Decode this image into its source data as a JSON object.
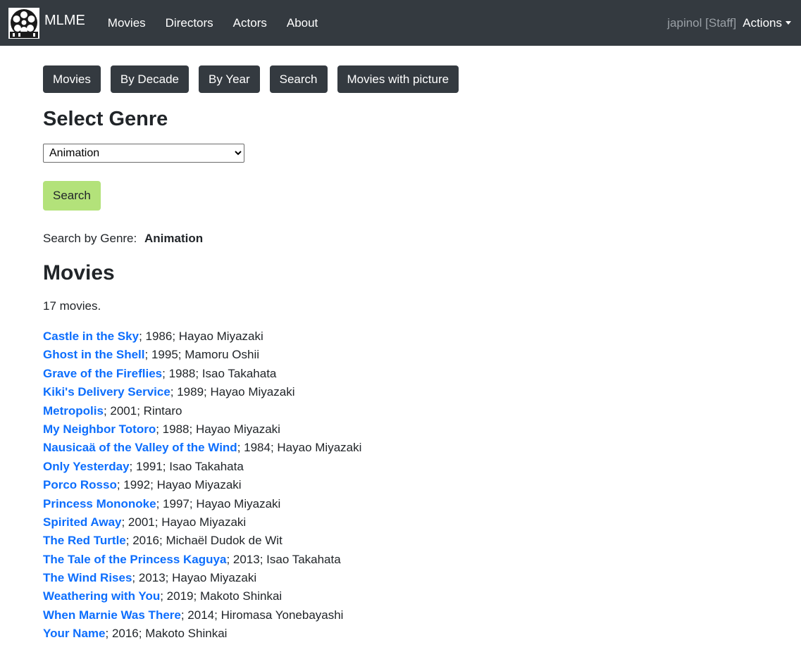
{
  "navbar": {
    "brand": "MLME",
    "links": [
      "Movies",
      "Directors",
      "Actors",
      "About"
    ],
    "user": "japinol [Staff]",
    "actions": "Actions",
    "logo_icon": "film-reel-icon",
    "caret_icon": "caret-down-icon"
  },
  "subnav": [
    "Movies",
    "By Decade",
    "By Year",
    "Search",
    "Movies with picture"
  ],
  "genre_form": {
    "title": "Select Genre",
    "selected": "Animation",
    "search_button": "Search"
  },
  "results": {
    "prefix": "Search by Genre:",
    "genre": "Animation",
    "title": "Movies",
    "count": "17 movies."
  },
  "movies": [
    {
      "title": "Castle in the Sky",
      "details": "; 1986; Hayao Miyazaki"
    },
    {
      "title": "Ghost in the Shell",
      "details": "; 1995; Mamoru Oshii"
    },
    {
      "title": "Grave of the Fireflies",
      "details": "; 1988; Isao Takahata"
    },
    {
      "title": "Kiki's Delivery Service",
      "details": "; 1989; Hayao Miyazaki"
    },
    {
      "title": "Metropolis",
      "details": "; 2001; Rintaro"
    },
    {
      "title": "My Neighbor Totoro",
      "details": "; 1988; Hayao Miyazaki"
    },
    {
      "title": "Nausicaä of the Valley of the Wind",
      "details": "; 1984; Hayao Miyazaki"
    },
    {
      "title": "Only Yesterday",
      "details": "; 1991; Isao Takahata"
    },
    {
      "title": "Porco Rosso",
      "details": "; 1992; Hayao Miyazaki"
    },
    {
      "title": "Princess Mononoke",
      "details": "; 1997; Hayao Miyazaki"
    },
    {
      "title": "Spirited Away",
      "details": "; 2001; Hayao Miyazaki"
    },
    {
      "title": "The Red Turtle",
      "details": "; 2016; Michaël Dudok de Wit"
    },
    {
      "title": "The Tale of the Princess Kaguya",
      "details": "; 2013; Isao Takahata"
    },
    {
      "title": "The Wind Rises",
      "details": "; 2013; Hayao Miyazaki"
    },
    {
      "title": "Weathering with You",
      "details": "; 2019; Makoto Shinkai"
    },
    {
      "title": "When Marnie Was There",
      "details": "; 2014; Hiromasa Yonebayashi"
    },
    {
      "title": "Your Name",
      "details": "; 2016; Makoto Shinkai"
    }
  ],
  "colors": {
    "navbar": "#343a40",
    "link": "#0d6efd",
    "search_button": "#b3e27a"
  }
}
